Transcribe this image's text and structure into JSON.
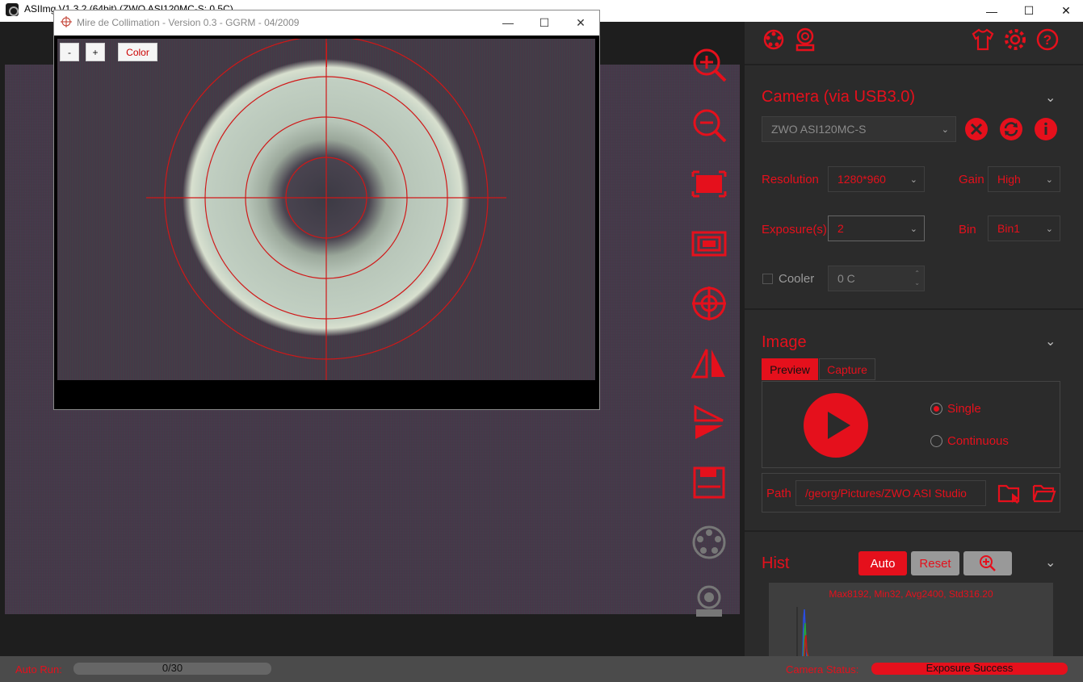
{
  "app": {
    "title": "ASIImg  V1.3.2 (64bit)  (ZWO ASI120MC-S: 0.5C)"
  },
  "window_controls": {
    "minimize": "—",
    "maximize": "☐",
    "close": "✕"
  },
  "collimation": {
    "title": "Mire de Collimation - Version 0.3 - GGRM - 04/2009",
    "minus_label": "-",
    "plus_label": "+",
    "color_label": "Color"
  },
  "toolbar_icons": [
    "zoom-in-icon",
    "zoom-out-icon",
    "fit-screen-icon",
    "actual-size-icon",
    "crosshair-icon",
    "flip-horizontal-icon",
    "flip-vertical-icon",
    "save-icon",
    "filter-wheel-icon",
    "focuser-icon"
  ],
  "top_icons": [
    "filter-wheel-icon",
    "focuser-icon",
    "shirt-icon",
    "gear-icon",
    "help-icon"
  ],
  "camera": {
    "heading": "Camera (via USB3.0)",
    "selected": "ZWO ASI120MC-S",
    "resolution_label": "Resolution",
    "resolution_value": "1280*960",
    "gain_label": "Gain",
    "gain_value": "High",
    "exposure_label": "Exposure(s)",
    "exposure_value": "2",
    "bin_label": "Bin",
    "bin_value": "Bin1",
    "cooler_label": "Cooler",
    "cooler_value": "0 C"
  },
  "image": {
    "heading": "Image",
    "tabs": [
      "Preview",
      "Capture"
    ],
    "mode_single": "Single",
    "mode_continuous": "Continuous",
    "path_label": "Path",
    "path_value": "/georg/Pictures/ZWO ASI Studio"
  },
  "hist": {
    "heading": "Hist",
    "auto_label": "Auto",
    "reset_label": "Reset",
    "stats": "Max8192, Min32, Avg2400, Std316.20"
  },
  "status": {
    "autorun_label": "Auto Run:",
    "autorun_value": "0/30",
    "autorun_progress": 0.0,
    "camera_status_label": "Camera Status:",
    "camera_status_value": "Exposure Success"
  },
  "colors": {
    "accent": "#e5101c",
    "panel": "#2b2b2b",
    "background": "#1e1e1e"
  }
}
